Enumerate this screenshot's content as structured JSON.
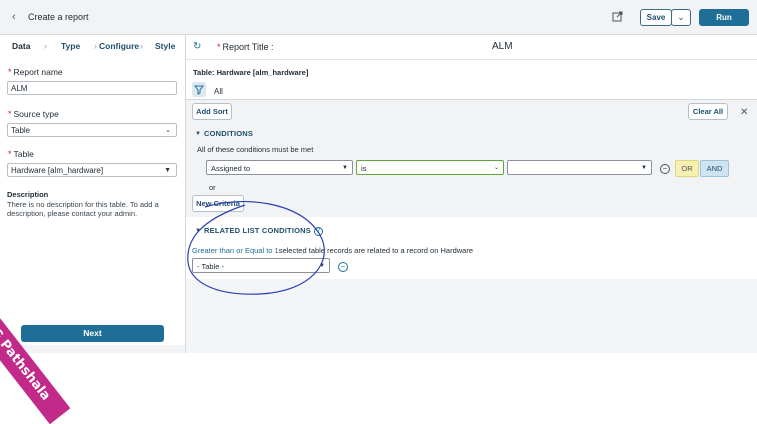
{
  "topbar": {
    "back_icon": "chevron-left",
    "title": "Create a report",
    "share_icon": "share",
    "save_label": "Save",
    "caret_icon": "chevron-down",
    "run_label": "Run"
  },
  "steps": [
    {
      "label": "Data"
    },
    {
      "label": "Type"
    },
    {
      "label": "Configure"
    },
    {
      "label": "Style"
    }
  ],
  "form": {
    "report_name_label": "Report name",
    "report_name_value": "ALM",
    "source_type_label": "Source type",
    "source_type_value": "Table",
    "table_label": "Table",
    "table_value": "Hardware [alm_hardware]",
    "description_heading": "Description",
    "description_text": "There is no description for this table. To add a description, please contact your admin.",
    "next_label": "Next"
  },
  "report": {
    "title_label": "Report Title :",
    "title_value": "ALM",
    "table_heading": "Table: Hardware [alm_hardware]",
    "filter_all": "All",
    "add_sort": "Add Sort",
    "clear_all": "Clear All"
  },
  "conditions": {
    "heading": "CONDITIONS",
    "note": "All of these conditions must be met",
    "field_value": "Assigned to",
    "operator_value": "is",
    "value_value": "",
    "or_label": "OR",
    "and_label": "AND",
    "or_text": "or",
    "new_criteria": "New Criteria"
  },
  "related": {
    "heading": "RELATED LIST CONDITIONS",
    "link_text": "Greater than or Equal to 1",
    "rest_text": "selected table records are related to a record on Hardware",
    "table_select": "- Table -"
  },
  "watermark": "LNG Pathshala",
  "colors": {
    "accent": "#1f6e97",
    "required": "#c2252c",
    "annotation": "#2a3fb5",
    "banner": "#c22a8a"
  }
}
